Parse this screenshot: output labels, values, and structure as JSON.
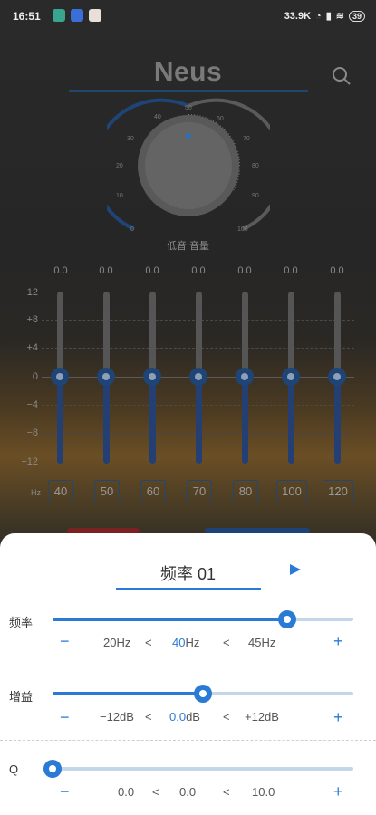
{
  "status_bar": {
    "time": "16:51",
    "network_speed": "33.9K",
    "battery": "39"
  },
  "app": {
    "title": "Neus",
    "knob": {
      "label": "低音 音量",
      "scale": [
        "0",
        "10",
        "20",
        "30",
        "40",
        "50",
        "60",
        "70",
        "80",
        "90",
        "100"
      ],
      "level": 50
    },
    "eq": {
      "band_values": [
        "0.0",
        "0.0",
        "0.0",
        "0.0",
        "0.0",
        "0.0",
        "0.0"
      ],
      "db_scale": [
        "+12",
        "+8",
        "+4",
        "0",
        "−4",
        "−8",
        "−12"
      ],
      "hz_unit": "Hz",
      "frequencies": [
        "40",
        "50",
        "60",
        "70",
        "80",
        "100",
        "120"
      ]
    }
  },
  "sheet": {
    "title": "频率 01",
    "params": [
      {
        "label": "频率",
        "min": "20Hz",
        "current_value": "40",
        "current_unit": "Hz",
        "max": "45Hz",
        "sep": "<",
        "minus": "−",
        "plus": "+",
        "level": 0.78
      },
      {
        "label": "增益",
        "min": "−12dB",
        "current_value": "0.0",
        "current_unit": "dB",
        "max": "+12dB",
        "sep": "<",
        "minus": "−",
        "plus": "+",
        "level": 0.5
      },
      {
        "label": "Q",
        "min": "0.0",
        "current_value": "0.0",
        "current_unit": "",
        "max": "10.0",
        "sep": "<",
        "minus": "−",
        "plus": "+",
        "level": 0.0
      }
    ]
  },
  "colors": {
    "accent": "#2a7bd6",
    "dim_accent": "#22476e"
  }
}
